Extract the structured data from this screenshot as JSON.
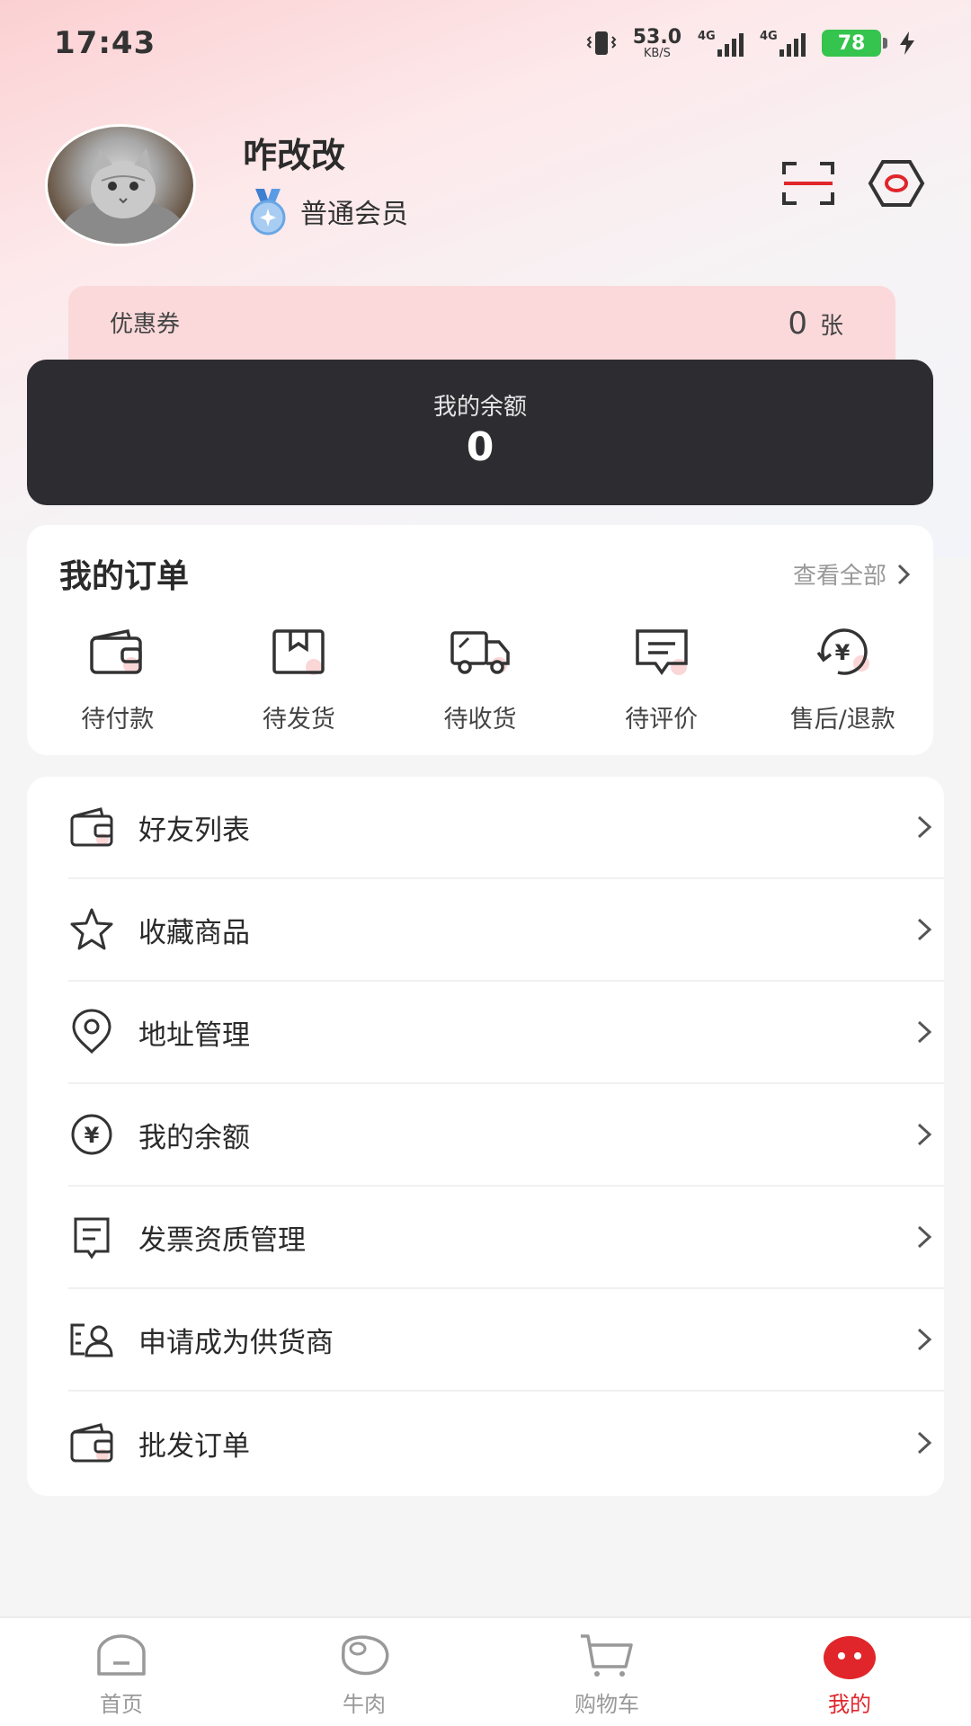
{
  "status_bar": {
    "time": "17:43",
    "speed_value": "53.0",
    "speed_unit": "KB/S",
    "signal_1_label": "4G",
    "signal_2_label": "4G",
    "battery": "78"
  },
  "profile": {
    "username": "咋改改",
    "member_level": "普通会员"
  },
  "coupon": {
    "label": "优惠券",
    "count": "0",
    "unit": "张"
  },
  "balance_card": {
    "title": "我的余额",
    "value": "0"
  },
  "orders": {
    "title": "我的订单",
    "view_all": "查看全部",
    "items": [
      {
        "label": "待付款",
        "icon": "wallet-icon"
      },
      {
        "label": "待发货",
        "icon": "package-icon"
      },
      {
        "label": "待收货",
        "icon": "truck-icon"
      },
      {
        "label": "待评价",
        "icon": "comment-icon"
      },
      {
        "label": "售后/退款",
        "icon": "refund-icon"
      }
    ]
  },
  "menu": {
    "items": [
      {
        "label": "好友列表",
        "icon": "wallet-icon"
      },
      {
        "label": "收藏商品",
        "icon": "star-icon"
      },
      {
        "label": "地址管理",
        "icon": "location-icon"
      },
      {
        "label": "我的余额",
        "icon": "yen-icon"
      },
      {
        "label": "发票资质管理",
        "icon": "invoice-icon"
      },
      {
        "label": "申请成为供货商",
        "icon": "supplier-icon"
      },
      {
        "label": "批发订单",
        "icon": "wallet-icon"
      }
    ]
  },
  "tabbar": {
    "items": [
      {
        "label": "首页",
        "icon": "home-icon"
      },
      {
        "label": "牛肉",
        "icon": "meat-icon"
      },
      {
        "label": "购物车",
        "icon": "cart-icon"
      },
      {
        "label": "我的",
        "icon": "profile-icon"
      }
    ],
    "active_index": 3
  },
  "colors": {
    "accent": "#e0262b",
    "balance_card_bg": "#2d2d31",
    "coupon_bg": "#fbd9da",
    "battery": "#35c44d"
  }
}
